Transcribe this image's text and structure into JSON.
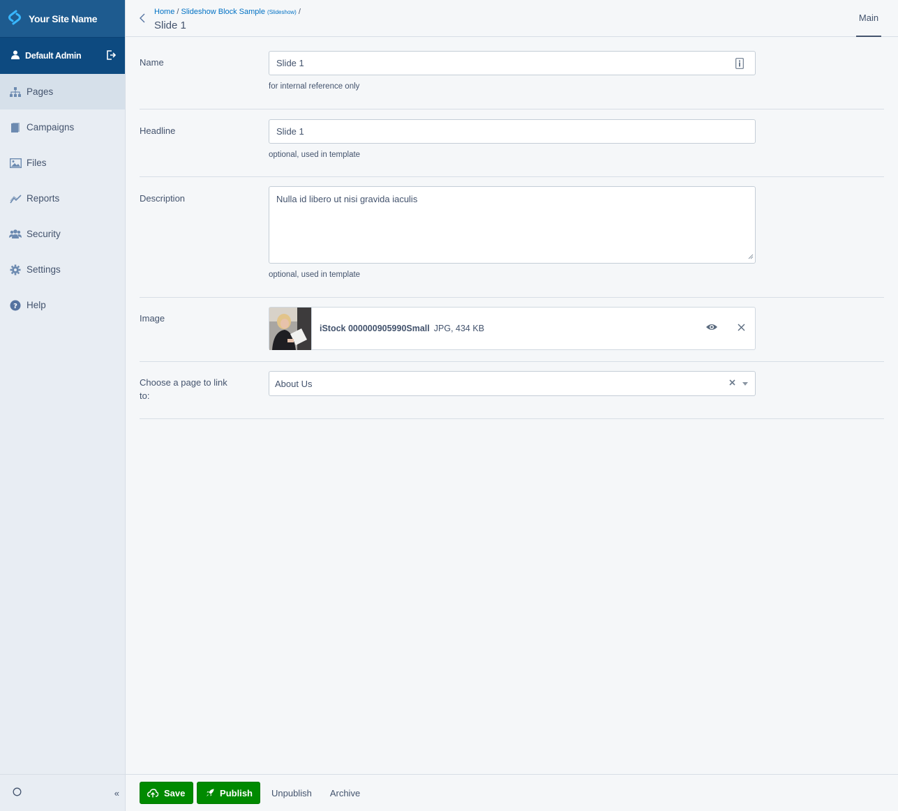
{
  "brand": {
    "name": "Your Site Name",
    "logo_icon": "silverstripe-logo-icon"
  },
  "user": {
    "name": "Default Admin",
    "icon": "user-icon",
    "logout_icon": "logout-icon"
  },
  "sidebar": {
    "items": [
      {
        "label": "Pages",
        "icon": "sitemap-icon",
        "active": true
      },
      {
        "label": "Campaigns",
        "icon": "campaigns-icon",
        "active": false
      },
      {
        "label": "Files",
        "icon": "image-icon",
        "active": false
      },
      {
        "label": "Reports",
        "icon": "chart-line-icon",
        "active": false
      },
      {
        "label": "Security",
        "icon": "users-icon",
        "active": false
      },
      {
        "label": "Settings",
        "icon": "gear-icon",
        "active": false
      },
      {
        "label": "Help",
        "icon": "help-icon",
        "active": false
      }
    ],
    "collapse_label": "«"
  },
  "header": {
    "breadcrumb_home": "Home",
    "breadcrumb_sep": "/",
    "breadcrumb_parent": "Slideshow Block Sample",
    "breadcrumb_parent_type": "(Slideshow)",
    "breadcrumb_sep2": "/",
    "title": "Slide 1",
    "tab": "Main"
  },
  "form": {
    "name": {
      "label": "Name",
      "value": "Slide 1",
      "help": "for internal reference only"
    },
    "headline": {
      "label": "Headline",
      "value": "Slide 1",
      "help": "optional, used in template"
    },
    "description": {
      "label": "Description",
      "value": "Nulla id libero ut nisi gravida iaculis",
      "help": "optional, used in template"
    },
    "image": {
      "label": "Image",
      "file_name": "iStock 000000905990Small",
      "file_meta": "JPG, 434 KB"
    },
    "link": {
      "label": "Choose a page to link to:",
      "value": "About Us"
    }
  },
  "actions": {
    "save": "Save",
    "publish": "Publish",
    "unpublish": "Unpublish",
    "archive": "Archive"
  },
  "colors": {
    "brand": "#1e5b8f",
    "user_bar": "#0d4a80",
    "primary_button": "#008a00",
    "link": "#0071c4"
  }
}
